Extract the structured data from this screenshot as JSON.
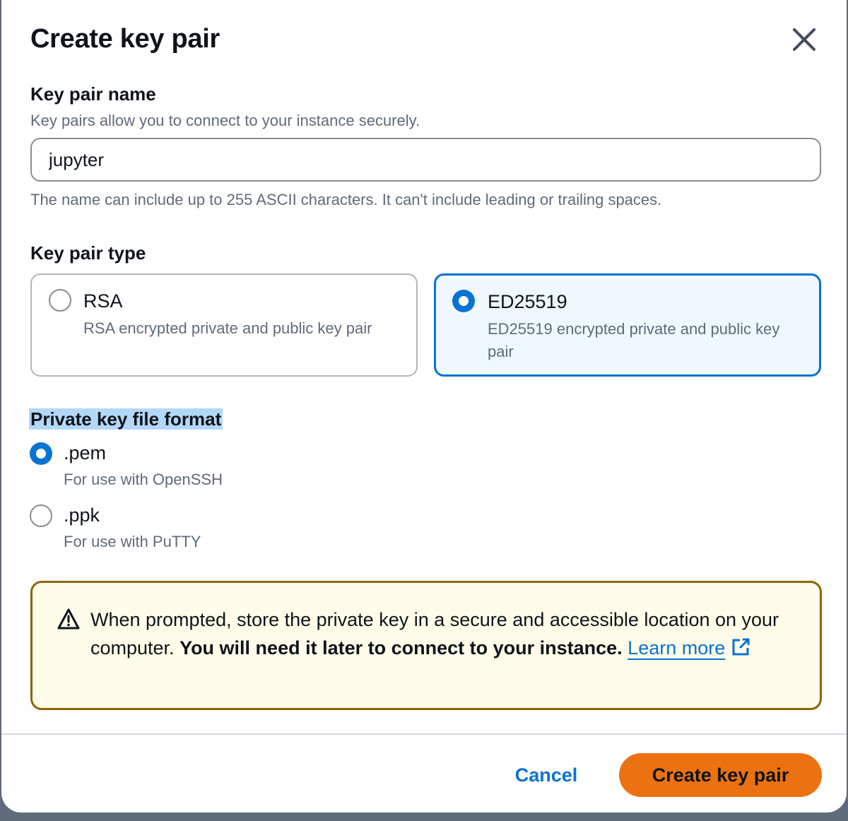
{
  "modal": {
    "title": "Create key pair",
    "close_icon": "close-icon"
  },
  "key_name": {
    "label": "Key pair name",
    "description": "Key pairs allow you to connect to your instance securely.",
    "value": "jupyter",
    "constraint": "The name can include up to 255 ASCII characters. It can't include leading or trailing spaces."
  },
  "key_type": {
    "label": "Key pair type",
    "options": [
      {
        "title": "RSA",
        "description": "RSA encrypted private and public key pair",
        "selected": false
      },
      {
        "title": "ED25519",
        "description": "ED25519 encrypted private and public key pair",
        "selected": true
      }
    ]
  },
  "file_format": {
    "label": "Private key file format",
    "options": [
      {
        "title": ".pem",
        "description": "For use with OpenSSH",
        "selected": true
      },
      {
        "title": ".ppk",
        "description": "For use with PuTTY",
        "selected": false
      }
    ]
  },
  "warning": {
    "icon": "warning-icon",
    "text": "When prompted, store the private key in a secure and accessible location on your computer. ",
    "bold": "You will need it later to connect to your instance.",
    "link": "Learn more",
    "link_icon": "external-link-icon"
  },
  "footer": {
    "cancel": "Cancel",
    "create": "Create key pair"
  },
  "colors": {
    "accent": "#0972d3",
    "primary_button": "#ec7211",
    "warning_border": "#8d6605",
    "warning_bg": "#fffce9"
  }
}
